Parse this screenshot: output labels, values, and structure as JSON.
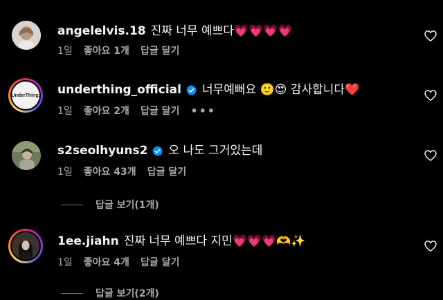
{
  "comments": [
    {
      "username": "angelelvis.18",
      "text": "진짜 너무 예쁘다💗💗💗💗",
      "time": "1일",
      "likes": "좋아요 1개",
      "reply": "답글 달기"
    },
    {
      "username": "underthing_official",
      "text": "너무예뻐요 🙂😍 감사합니다❤️",
      "avatar_text": "UnderThing.",
      "time": "1일",
      "likes": "좋아요 2개",
      "reply": "답글 달기",
      "more": "•••"
    },
    {
      "username": "s2seolhyuns2",
      "text": "오 나도 그거있는데",
      "time": "1일",
      "likes": "좋아요 43개",
      "reply": "답글 달기",
      "view_replies": "답글 보기(1개)"
    },
    {
      "username": "1ee.jiahn",
      "text": "진짜 너무 예쁘다 지민💗💗💗🫶✨",
      "time": "1일",
      "likes": "좋아요 4개",
      "reply": "답글 달기",
      "view_replies": "답글 보기(2개)"
    }
  ],
  "colors": {
    "background": "#000000",
    "verified": "#0095f6",
    "secondary_text": "#a8a8a8"
  },
  "icons": [
    "verified-badge-icon",
    "heart-outline-icon"
  ]
}
